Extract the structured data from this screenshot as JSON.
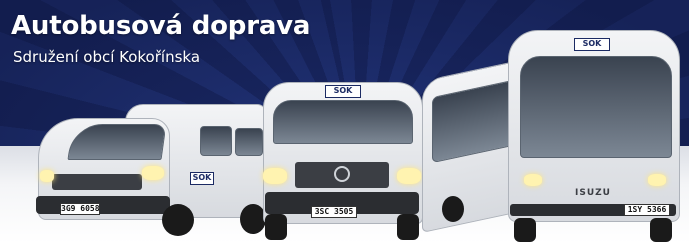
{
  "banner": {
    "title": "Autobusová doprava",
    "subtitle": "Sdružení obcí Kokořínska"
  },
  "vehicles": {
    "van_left": {
      "logo": "SOK",
      "plate": "3G9 6058"
    },
    "van_center": {
      "logo": "SOK",
      "plate": "3SC 3505"
    },
    "bus_right": {
      "logo": "SOK",
      "brand": "ISUZU",
      "plate": "1SY 5366"
    }
  },
  "colors": {
    "background_navy": "#1b2a63",
    "text": "#ffffff",
    "vehicle_body": "#e6e8ec"
  }
}
